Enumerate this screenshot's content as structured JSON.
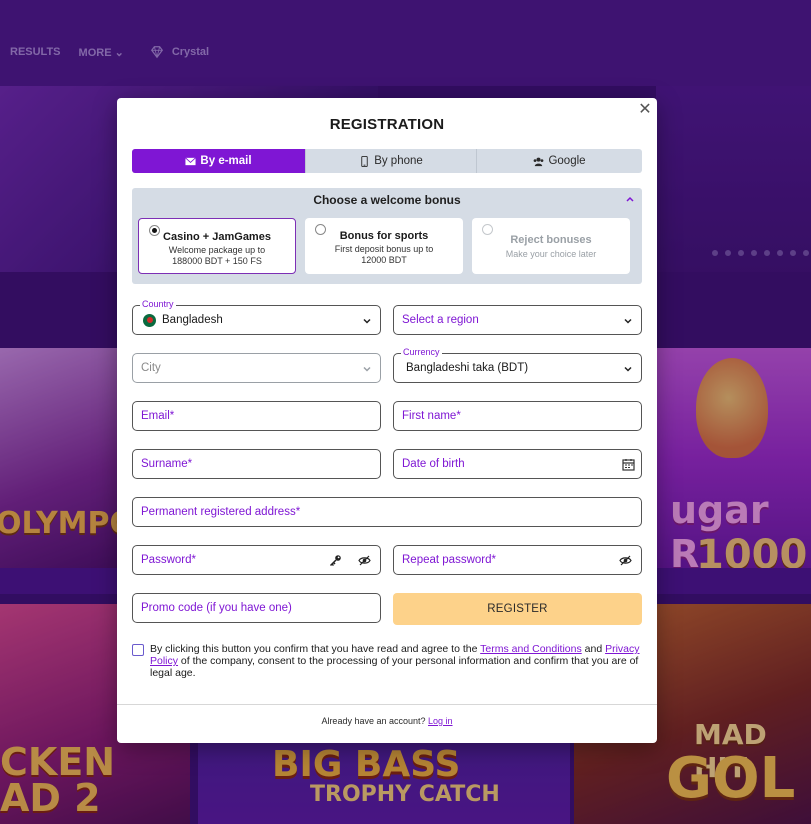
{
  "background": {
    "nav": [
      "RESULTS",
      "MORE",
      "Crystal"
    ],
    "tiles": {
      "zeus": "OLYMPO",
      "sugar": "ugar R",
      "sugar2": "1000",
      "chicken": "CKEN\nAD 2",
      "bass": "BIG BASS",
      "bass_sub": "TROPHY CATCH",
      "gold": "MAD HIT",
      "gold2": "GOL"
    }
  },
  "modal": {
    "title": "REGISTRATION",
    "close_icon": "close-icon",
    "tabs": [
      {
        "label": "By e-mail",
        "icon": "envelope-icon",
        "active": true
      },
      {
        "label": "By phone",
        "icon": "phone-icon",
        "active": false
      },
      {
        "label": "Google",
        "icon": "users-icon",
        "active": false
      }
    ],
    "bonus": {
      "header": "Choose a welcome bonus",
      "options": [
        {
          "title": "Casino + JamGames",
          "desc": "Welcome package up to 188000 BDT + 150 FS",
          "selected": true
        },
        {
          "title": "Bonus for sports",
          "desc": "First deposit bonus up to 12000 BDT",
          "selected": false
        },
        {
          "title": "Reject bonuses",
          "desc": "Make your choice later",
          "selected": false
        }
      ]
    },
    "form": {
      "country_label": "Country",
      "country_value": "Bangladesh",
      "region_placeholder": "Select a region",
      "city_placeholder": "City",
      "currency_label": "Currency",
      "currency_value": "Bangladeshi taka (BDT)",
      "email_placeholder": "Email*",
      "firstname_placeholder": "First name*",
      "surname_placeholder": "Surname*",
      "dob_placeholder": "Date of birth",
      "address_placeholder": "Permanent registered address*",
      "password_placeholder": "Password*",
      "repeat_password_placeholder": "Repeat password*",
      "promo_placeholder": "Promo code (if you have one)",
      "register_label": "REGISTER"
    },
    "terms": {
      "prefix": "By clicking this button you confirm that you have read and agree to the ",
      "terms_link": "Terms and Conditions",
      "middle": " and ",
      "privacy_link": "Privacy Policy",
      "suffix": " of the company, consent to the processing of your personal information and confirm that you are of legal age."
    },
    "footer": {
      "text": "Already have an account? ",
      "login_link": "Log in"
    }
  },
  "colors": {
    "accent": "#7f16d4",
    "register_button": "#fdd28a",
    "tab_bg": "#d5dce5"
  }
}
